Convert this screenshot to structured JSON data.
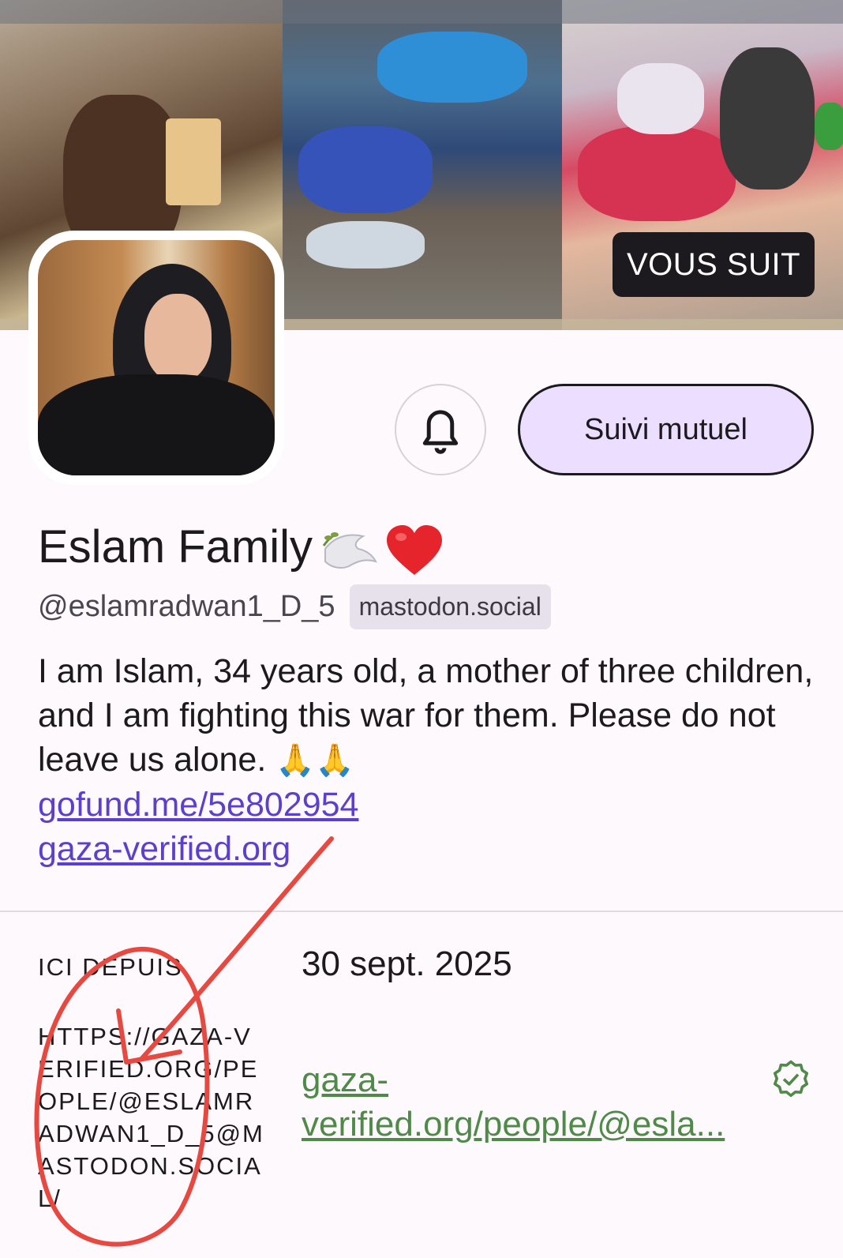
{
  "header": {
    "follows_you_badge": "VOUS SUIT"
  },
  "actions": {
    "bell_icon": "bell-icon",
    "mutual_follow_label": "Suivi mutuel",
    "mutual_follow_color": "#ebdeff"
  },
  "profile": {
    "display_name": "Eslam Family",
    "handle": "@eslamradwan1_D_5",
    "server": "mastodon.social",
    "bio_text": "I am Islam, 34 years old, a mother of three children, and I am fighting this war for them. Please do not leave us alone.",
    "bio_links": [
      "gofund.me/5e802954",
      "gaza-verified.org"
    ],
    "link_color": "#5b3fd1"
  },
  "fields": {
    "joined_label": "ICI DEPUIS",
    "joined_value": "30 sept. 2025",
    "verified_field_label": "HTTPS://GAZA-VERIFIED.ORG/PEOPLE/@ESLAMRADWAN1_D_5@MASTODON.SOCIAL/",
    "verified_field_value": "gaza-verified.org/people/@esla...",
    "verified_color": "#4f8a48"
  },
  "annotation": {
    "color": "#e8483f"
  }
}
